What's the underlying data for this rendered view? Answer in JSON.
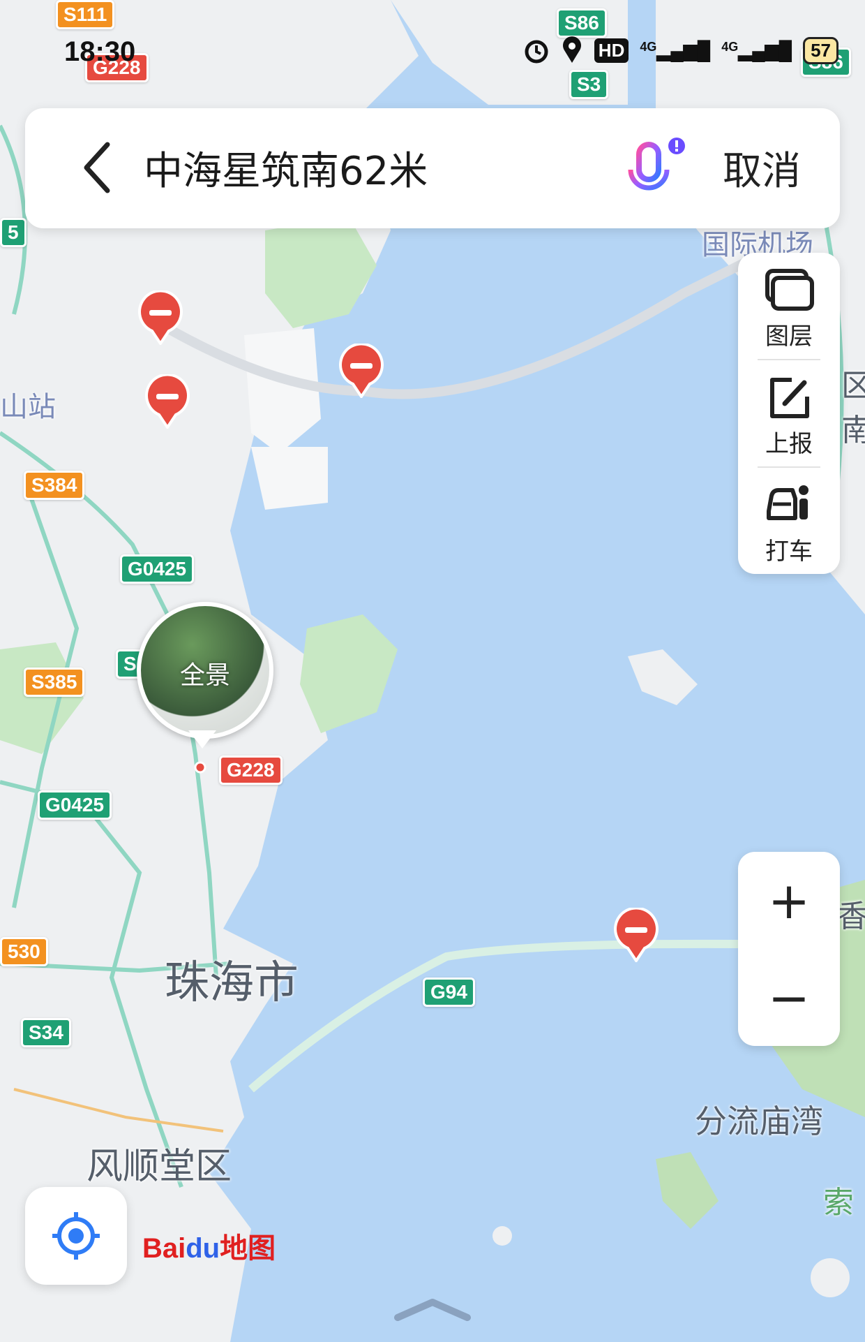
{
  "status_bar": {
    "time": "18:30",
    "hd_label": "HD",
    "net1": "4G",
    "net2": "4G",
    "battery": "57"
  },
  "search": {
    "query": "中海星筑南62米",
    "cancel_label": "取消"
  },
  "side_panel": {
    "items": [
      {
        "label": "图层",
        "icon": "layers-icon"
      },
      {
        "label": "上报",
        "icon": "report-edit-icon"
      },
      {
        "label": "打车",
        "icon": "taxi-icon"
      }
    ]
  },
  "zoom": {
    "in_label": "+",
    "out_label": "−"
  },
  "panorama": {
    "label": "全景"
  },
  "logo": {
    "text": "Bai",
    "paw": "du",
    "suffix": "地图"
  },
  "map": {
    "places": [
      {
        "name": "珠海市"
      },
      {
        "name": "风顺堂区"
      },
      {
        "name": "分流庙湾"
      },
      {
        "name": "国际机场"
      },
      {
        "name": "山站"
      },
      {
        "name": "香"
      },
      {
        "name": "索"
      },
      {
        "name": "区"
      },
      {
        "name": "南"
      }
    ],
    "shields": [
      {
        "code": "S111",
        "color": "orange"
      },
      {
        "code": "S86",
        "color": "green"
      },
      {
        "code": "S3",
        "color": "green"
      },
      {
        "code": "G228",
        "color": "red"
      },
      {
        "code": "S86",
        "color": "green"
      },
      {
        "code": "S384",
        "color": "orange"
      },
      {
        "code": "G0425",
        "color": "green"
      },
      {
        "code": "S385",
        "color": "orange"
      },
      {
        "code": "S",
        "color": "green"
      },
      {
        "code": "G228",
        "color": "red"
      },
      {
        "code": "G0425",
        "color": "green"
      },
      {
        "code": "530",
        "color": "orange"
      },
      {
        "code": "S34",
        "color": "green"
      },
      {
        "code": "G94",
        "color": "green"
      },
      {
        "code": "5",
        "color": "green"
      }
    ],
    "colors": {
      "sea": "#b5d5f5",
      "land": "#eef0f2",
      "green": "#bfe3b8",
      "road": "#8fd6c2"
    }
  }
}
